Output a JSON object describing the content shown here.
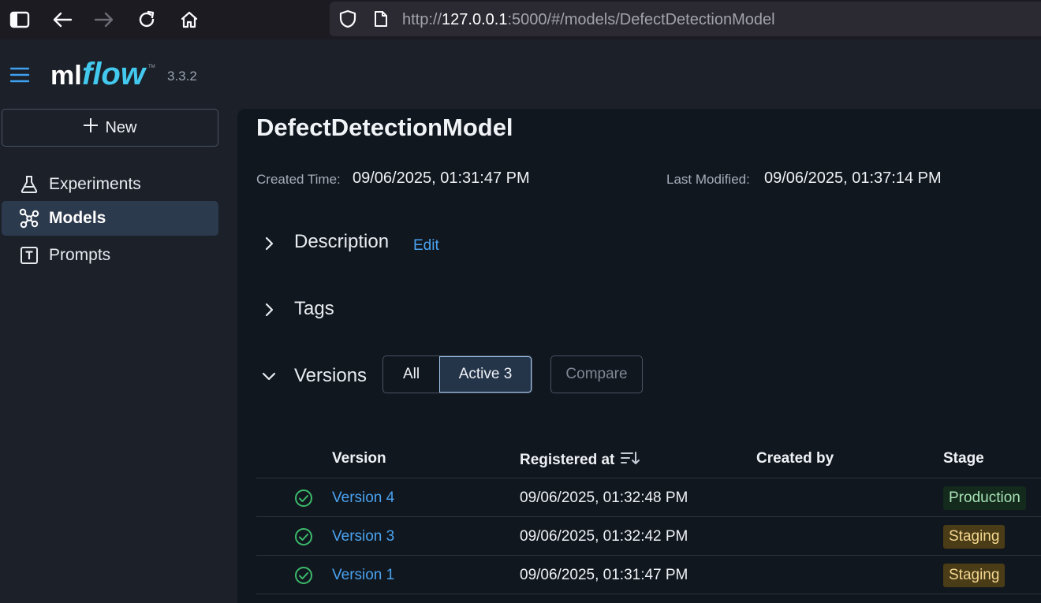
{
  "browser": {
    "url_prefix": "http://",
    "url_host": "127.0.0.1",
    "url_rest": ":5000/#/models/DefectDetectionModel"
  },
  "app": {
    "version": "3.3.2",
    "brand_color": "#43c9ed"
  },
  "sidebar": {
    "new_label": "New",
    "items": [
      {
        "label": "Experiments",
        "icon": "flask-icon",
        "active": false
      },
      {
        "label": "Models",
        "icon": "models-icon",
        "active": true
      },
      {
        "label": "Prompts",
        "icon": "prompt-icon",
        "active": false
      }
    ]
  },
  "model": {
    "title": "DefectDetectionModel",
    "created_label": "Created Time:",
    "created_value": "09/06/2025, 01:31:47 PM",
    "modified_label": "Last Modified:",
    "modified_value": "09/06/2025, 01:37:14 PM"
  },
  "sections": {
    "description": "Description",
    "edit": "Edit",
    "tags": "Tags",
    "versions": "Versions"
  },
  "versions_filter": {
    "all": "All",
    "active": "Active 3",
    "compare": "Compare"
  },
  "table": {
    "headers": {
      "version": "Version",
      "registered_at": "Registered at",
      "created_by": "Created by",
      "stage": "Stage"
    },
    "rows": [
      {
        "version": "Version 4",
        "registered_at": "09/06/2025, 01:32:48 PM",
        "created_by": "",
        "stage": "Production"
      },
      {
        "version": "Version 3",
        "registered_at": "09/06/2025, 01:32:42 PM",
        "created_by": "",
        "stage": "Staging"
      },
      {
        "version": "Version 1",
        "registered_at": "09/06/2025, 01:31:47 PM",
        "created_by": "",
        "stage": "Staging"
      }
    ]
  }
}
